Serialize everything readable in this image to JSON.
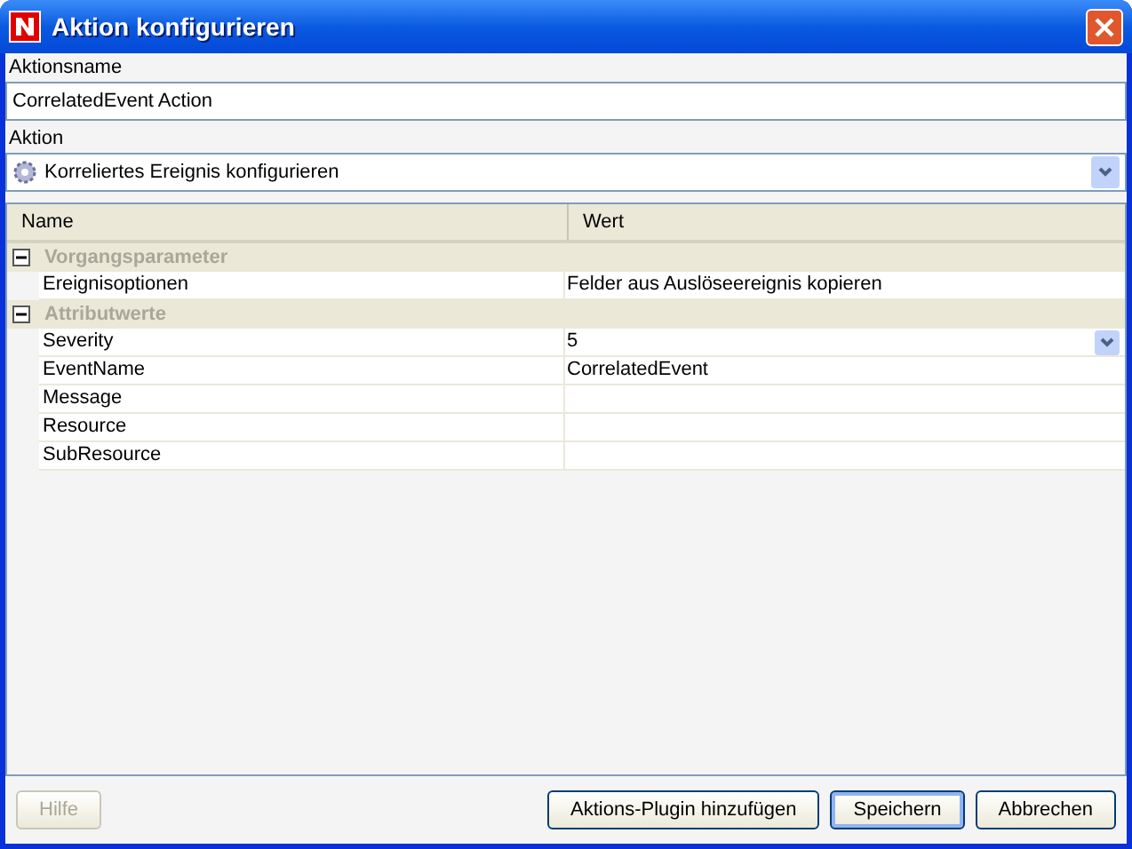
{
  "window": {
    "title": "Aktion konfigurieren"
  },
  "action_name": {
    "label": "Aktionsname",
    "value": "CorrelatedEvent Action"
  },
  "action": {
    "label": "Aktion",
    "value": "Korreliertes Ereignis konfigurieren"
  },
  "table": {
    "columns": [
      "Name",
      "Wert"
    ],
    "groups": [
      {
        "label": "Vorgangsparameter",
        "expanded": true,
        "rows": [
          {
            "kind": "text",
            "name": "Ereignisoptionen",
            "value": "Felder aus Auslöseereignis kopieren"
          }
        ]
      },
      {
        "label": "Attributwerte",
        "expanded": true,
        "rows": [
          {
            "kind": "dropdown",
            "name": "Severity",
            "value": "5"
          },
          {
            "kind": "text",
            "name": "EventName",
            "value": "CorrelatedEvent"
          },
          {
            "kind": "text",
            "name": "Message"
          },
          {
            "kind": "text",
            "name": "Resource"
          },
          {
            "kind": "text",
            "name": "SubResource"
          }
        ]
      }
    ]
  },
  "buttons": [
    {
      "label": "Hilfe",
      "disabled": true,
      "default": false
    },
    {
      "label": "Aktions-Plugin hinzufügen",
      "disabled": false,
      "default": false
    },
    {
      "label": "Speichern",
      "disabled": false,
      "default": true
    },
    {
      "label": "Abbrechen",
      "disabled": false,
      "default": false
    }
  ]
}
